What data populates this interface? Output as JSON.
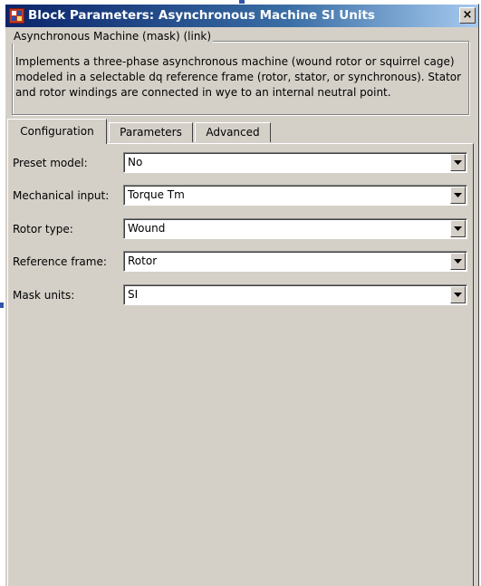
{
  "window": {
    "title": "Block Parameters: Asynchronous Machine SI Units",
    "close_glyph": "×",
    "app_icon": "simulink-block-icon"
  },
  "description": {
    "legend": "Asynchronous Machine (mask) (link)",
    "lines": [
      "Implements a three-phase asynchronous machine (wound rotor or squirrel cage)",
      "modeled in a selectable  dq reference frame (rotor, stator, or synchronous). Stator",
      "and rotor windings are connected in wye to an internal neutral point."
    ]
  },
  "tabs": [
    {
      "label": "Configuration",
      "active": true
    },
    {
      "label": "Parameters",
      "active": false
    },
    {
      "label": "Advanced",
      "active": false
    }
  ],
  "fields": [
    {
      "label": "Preset model:",
      "value": "No"
    },
    {
      "label": "Mechanical input:",
      "value": "Torque Tm"
    },
    {
      "label": "Rotor type:",
      "value": "Wound"
    },
    {
      "label": "Reference frame:",
      "value": "Rotor"
    },
    {
      "label": "Mask units:",
      "value": "SI"
    }
  ],
  "colors": {
    "face": "#d4d0c8",
    "title_start": "#0a246a",
    "title_end": "#a6caf0"
  }
}
